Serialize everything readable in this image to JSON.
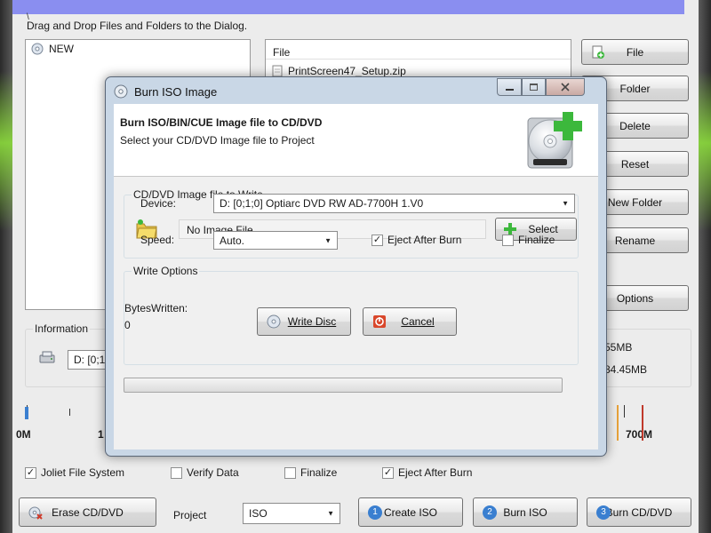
{
  "main": {
    "path_text": "\\",
    "drag_hint": "Drag and Drop Files and Folders to the Dialog.",
    "tree": {
      "root_label": "NEW"
    },
    "file_list": {
      "header": "File",
      "rows": [
        "PrintScreen47_Setup.zip"
      ]
    },
    "side_buttons": {
      "file": "File",
      "folder": "Folder",
      "delete": "Delete",
      "reset": "Reset",
      "new_folder": "New Folder",
      "rename": "Rename",
      "options": "Options"
    },
    "information": {
      "label": "Information",
      "device_value": "D: [0;1",
      "size_1": "55MB",
      "size_2": "84.45MB"
    },
    "ruler": {
      "labels": [
        "0M",
        "1",
        "700M"
      ]
    },
    "options": {
      "joliet": {
        "label": "Joliet File System",
        "checked": true
      },
      "verify": {
        "label": "Verify Data",
        "checked": false
      },
      "finalize": {
        "label": "Finalize",
        "checked": false
      },
      "eject": {
        "label": "Eject After Burn",
        "checked": true
      }
    },
    "bottom": {
      "erase_button": "Erase CD/DVD",
      "project_label": "Project",
      "project_value": "ISO",
      "create_iso_button": "Create ISO",
      "create_iso_step": "1",
      "burn_iso_button": "Burn ISO",
      "burn_iso_step": "2",
      "burn_cd_button": "Burn CD/DVD",
      "burn_cd_step": "3"
    }
  },
  "dialog": {
    "title": "Burn ISO Image",
    "header_title": "Burn ISO/BIN/CUE Image file to CD/DVD",
    "header_subtitle": "Select your CD/DVD Image file to Project",
    "image_group": {
      "title": "CD/DVD Image file to Write",
      "value": "No Image File",
      "select_button": "Select"
    },
    "write_options": {
      "title": "Write Options",
      "device_label": "Device:",
      "device_value": "D: [0;1;0] Optiarc  DVD RW AD-7700H  1.V0",
      "speed_label": "Speed:",
      "speed_value": "Auto.",
      "eject": {
        "label": "Eject After Burn",
        "checked": true
      },
      "finalize": {
        "label": "Finalize",
        "checked": false
      }
    },
    "progress_value": 0,
    "bytes_label": "BytesWritten:",
    "bytes_value": "0",
    "write_button": "Write Disc",
    "cancel_button": "Cancel"
  },
  "colors": {
    "title_strip": "#8a8ef0",
    "green_plus": "#3cb83c",
    "ruler_marker_red": "#c0392b",
    "ruler_marker_orange": "#e6a13a"
  }
}
